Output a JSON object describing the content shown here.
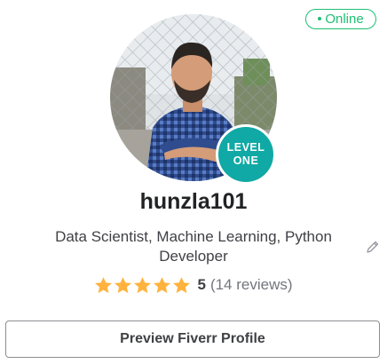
{
  "status": {
    "dot": "•",
    "label": "Online",
    "color": "#1dbf73"
  },
  "avatar": {
    "icon": "profile-photo",
    "alt": "hunzla101"
  },
  "level_badge": {
    "line1": "LEVEL",
    "line2": "ONE",
    "color": "#10a9a5"
  },
  "username": "hunzla101",
  "tagline": "Data Scientist, Machine Learning, Python Developer",
  "rating": {
    "stars": 5,
    "max": 5,
    "score": "5",
    "reviews": "(14 reviews)",
    "star_color": "#ffb33e"
  },
  "edit_icon": "pencil-icon",
  "preview_button": {
    "label": "Preview Fiverr Profile"
  }
}
